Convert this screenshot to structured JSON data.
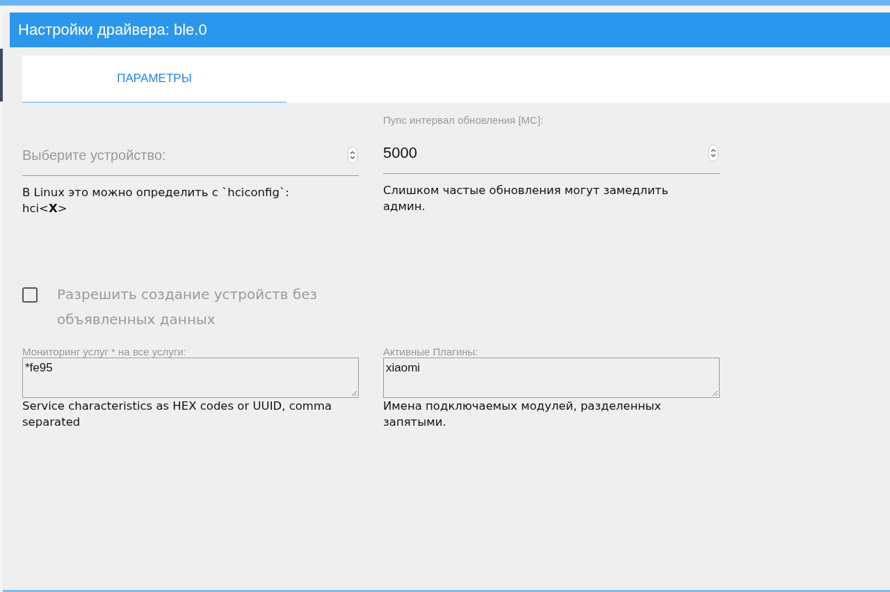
{
  "dialog": {
    "title": "Настройки драйвера: ble.0"
  },
  "tabs": [
    {
      "label": "ПАРАМЕТРЫ",
      "selected": true
    }
  ],
  "device_select": {
    "placeholder": "Выберите устройство:",
    "hint": "В Linux это можно определить с `hciconfig`: hci<**X**>"
  },
  "update_interval": {
    "label": "Пупс интервал обновления [МС]:",
    "value": "5000",
    "hint": "Слишком частые обновления могут замедлить админ."
  },
  "allow_no_ad": {
    "label": "Разрешить создание устройств без объявленных данных",
    "checked": false
  },
  "services": {
    "label": "Мониторинг услуг * на все услуги:",
    "value": "*fe95",
    "hint": "Service characteristics as HEX codes or UUID, comma separated"
  },
  "plugins": {
    "label": "Активные Плагины:",
    "value": "xiaomi",
    "hint": "Имена подключаемых модулей, разделенных запятыми."
  }
}
